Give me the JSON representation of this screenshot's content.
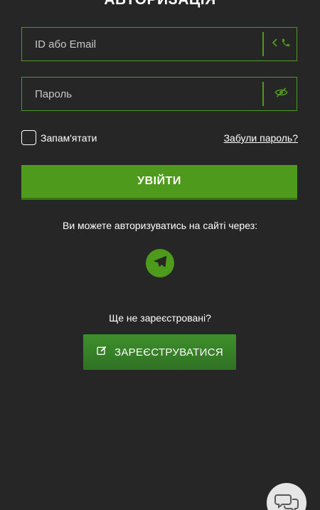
{
  "title": "АВТОРИЗАЦІЯ",
  "login_field": {
    "placeholder": "ID або Email",
    "value": "",
    "icons": [
      "chevron-left-icon",
      "phone-icon"
    ]
  },
  "password_field": {
    "placeholder": "Пароль",
    "value": "",
    "icon": "eye-slash-icon"
  },
  "remember": {
    "label": "Запам'ятати",
    "checked": false
  },
  "forgot_link": "Забули пароль?",
  "login_button": "УВІЙТИ",
  "via_text": "Ви можете авторизуватись на сайті через:",
  "social": [
    "telegram-icon"
  ],
  "not_registered_text": "Ще не зареєстровані?",
  "register_button": "ЗАРЕЄСТРУВАТИСЯ",
  "chat_widget_icon": "chat-bubbles-icon",
  "colors": {
    "background": "#262626",
    "accent": "#4e9a1c",
    "register_button": "#3a8228",
    "text": "#ffffff"
  }
}
